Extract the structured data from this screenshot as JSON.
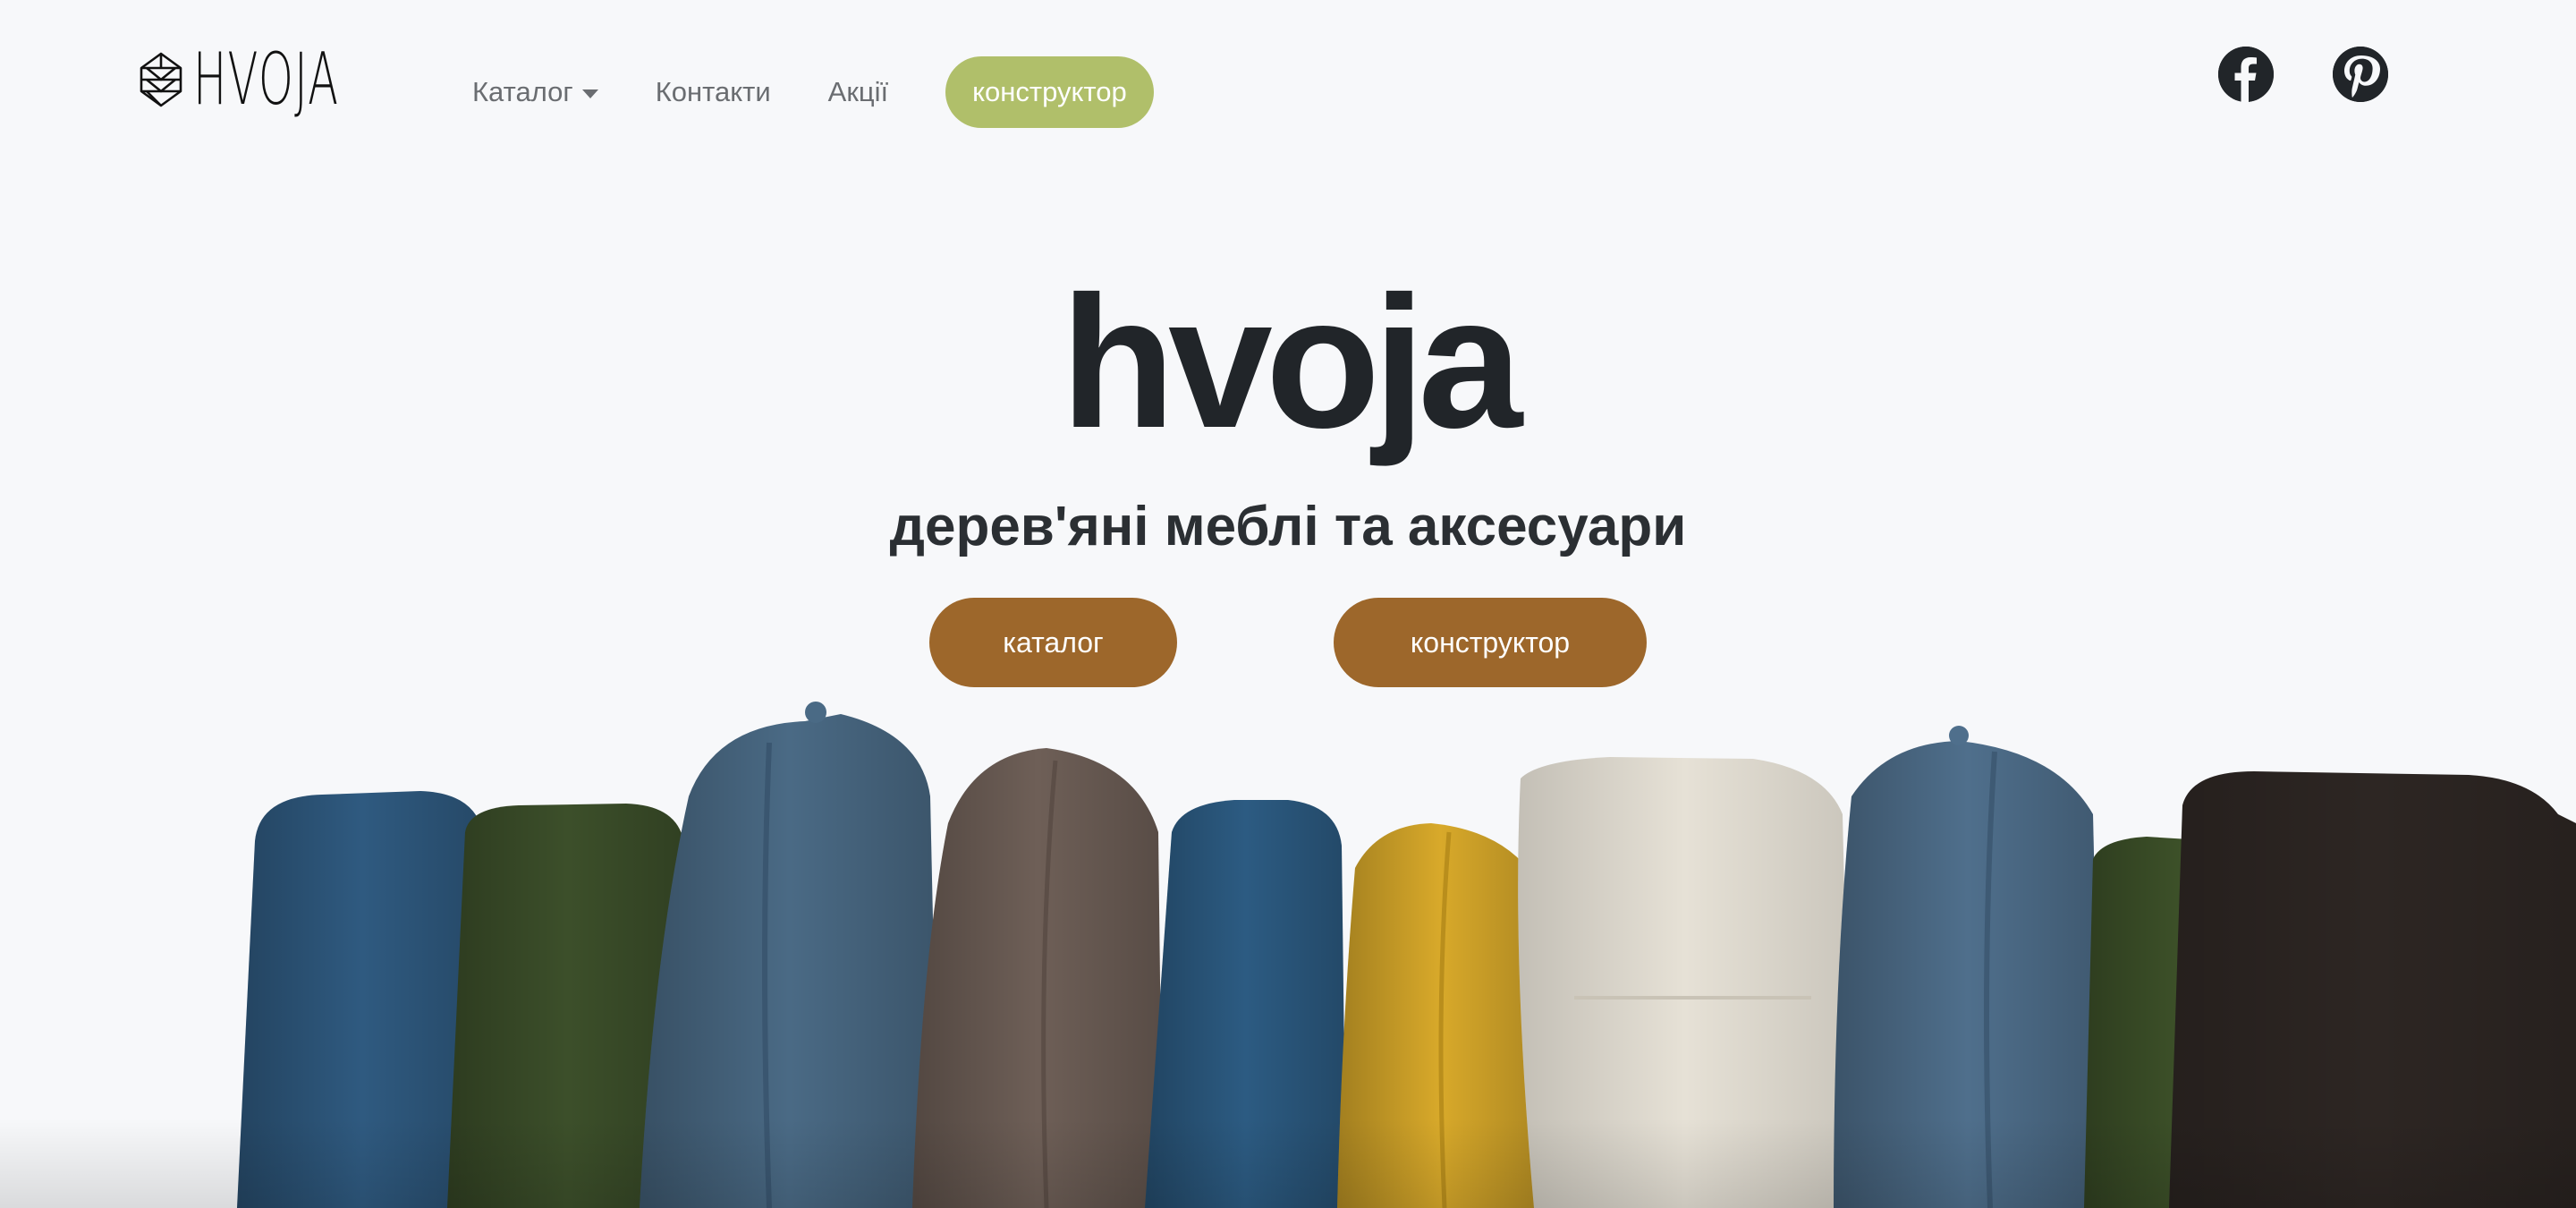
{
  "brand": {
    "logo_text": "HVOJA",
    "logo_icon": "pinecone-icon"
  },
  "nav": {
    "catalog_label": "Каталог",
    "contacts_label": "Контакти",
    "promotions_label": "Акції",
    "builder_label": "конструктор",
    "builder_color": "#b0bf6a"
  },
  "social": {
    "facebook_icon": "facebook-icon",
    "pinterest_icon": "pinterest-icon"
  },
  "hero": {
    "title": "hvoja",
    "subtitle": "дерев'яні меблі та аксесуари",
    "catalog_button": "каталог",
    "builder_button": "конструктор",
    "button_color": "#9d672b"
  },
  "colors": {
    "background": "#f7f8fa",
    "text": "#212529",
    "nav_text": "#6a6d71"
  },
  "image": {
    "subject": "cushions",
    "cushion_colors": [
      "#2f5a80",
      "#3c4f2a",
      "#4a6a85",
      "#6e5f57",
      "#2c5b82",
      "#d8a92a",
      "#e6e1d6",
      "#4f6f8c",
      "#3d5129",
      "#2d2623"
    ]
  }
}
